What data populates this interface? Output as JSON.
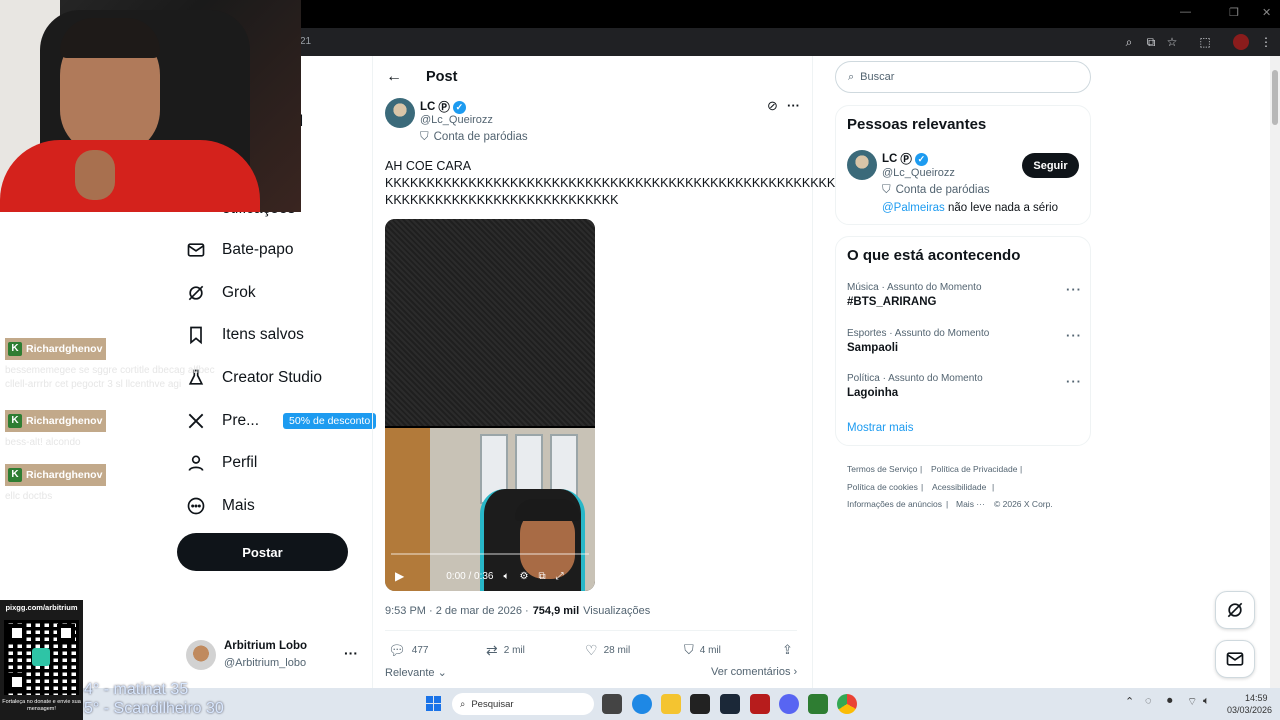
{
  "browser": {
    "url_fragment": "21",
    "window_controls": [
      "—",
      "❐",
      "✕"
    ]
  },
  "overlay": {
    "partial_nav": [
      "al",
      "otificações"
    ],
    "chat": [
      {
        "user": "Richardghenov",
        "message_lines": [
          "bessememegee se sggre cortitle dbecag alfbec",
          "cllell-arrrbr cet pegoctr 3 sl llcenthve agi"
        ]
      },
      {
        "user": "Richardghenov",
        "message_lines": [
          "bess-alt! alcondo"
        ]
      },
      {
        "user": "Richardghenov",
        "message_lines": [
          "ellc doctbs"
        ]
      }
    ],
    "qr_url": "pixgg.com/arbitrium",
    "qr_note": "Fortaleça no donate e envie sua mensagem!",
    "ranking": [
      "4° - matinat 35",
      "5° - Scandilheiro 30"
    ]
  },
  "nav": {
    "items": [
      {
        "label": "Bate-papo",
        "icon": "mail-icon"
      },
      {
        "label": "Grok",
        "icon": "grok-icon"
      },
      {
        "label": "Itens salvos",
        "icon": "bookmark-icon"
      },
      {
        "label": "Creator Studio",
        "icon": "flask-icon"
      },
      {
        "label": "Pre...",
        "icon": "x-logo-icon",
        "badge": "50% de desconto"
      },
      {
        "label": "Perfil",
        "icon": "person-icon"
      },
      {
        "label": "Mais",
        "icon": "more-circle-icon"
      }
    ],
    "post_button": "Postar",
    "account": {
      "name": "Arbitrium Lobo",
      "handle": "@Arbitrium_lobo"
    }
  },
  "post": {
    "header_title": "Post",
    "author_name": "LC",
    "author_emoji": "Ⓟ",
    "author_handle": "@Lc_Queirozz",
    "parody_label": "Conta de paródias",
    "text_line1": "AH COE CARA",
    "text_line2": "KKKKKKKKKKKKKKKKKKKKKKKKKKKKKKKKKKKKKKKKKKKKKKKKKKKKKK",
    "text_line3": "KKKKKKKKKKKKKKKKKKKKKKKKKKKK",
    "video_time": "0:00 / 0:36",
    "timestamp": "9:53 PM · 2 de mar de 2026 ·",
    "views_count": "754,9 mil",
    "views_label": "Visualizações",
    "replies": "477",
    "reposts": "2 mil",
    "likes": "28 mil",
    "bookmarks": "4 mil",
    "sort_label": "Relevante",
    "view_comments": "Ver comentários"
  },
  "right": {
    "search_placeholder": "Buscar",
    "relevant_title": "Pessoas relevantes",
    "person_name": "LC",
    "person_emoji": "Ⓟ",
    "person_handle": "@Lc_Queirozz",
    "person_parody": "Conta de paródias",
    "follow_label": "Seguir",
    "bio_mention": "@Palmeiras",
    "bio_rest": "não leve nada a sério",
    "trends_title": "O que está acontecendo",
    "trends": [
      {
        "category": "Música · Assunto do Momento",
        "name": "#BTS_ARIRANG"
      },
      {
        "category": "Esportes · Assunto do Momento",
        "name": "Sampaoli"
      },
      {
        "category": "Política · Assunto do Momento",
        "name": "Lagoinha"
      }
    ],
    "show_more": "Mostrar mais",
    "footer": {
      "terms": "Termos de Serviço",
      "privacy": "Política de Privacidade",
      "cookies": "Política de cookies",
      "accessibility": "Acessibilidade",
      "ads": "Informações de anúncios",
      "more": "Mais ···",
      "copyright": "© 2026 X Corp."
    }
  },
  "taskbar": {
    "search_label": "Pesquisar",
    "time": "14:59",
    "date": "03/03/2026"
  },
  "colors": {
    "accent": "#1d9bf0",
    "text": "#0f1419",
    "muted": "#536471"
  }
}
